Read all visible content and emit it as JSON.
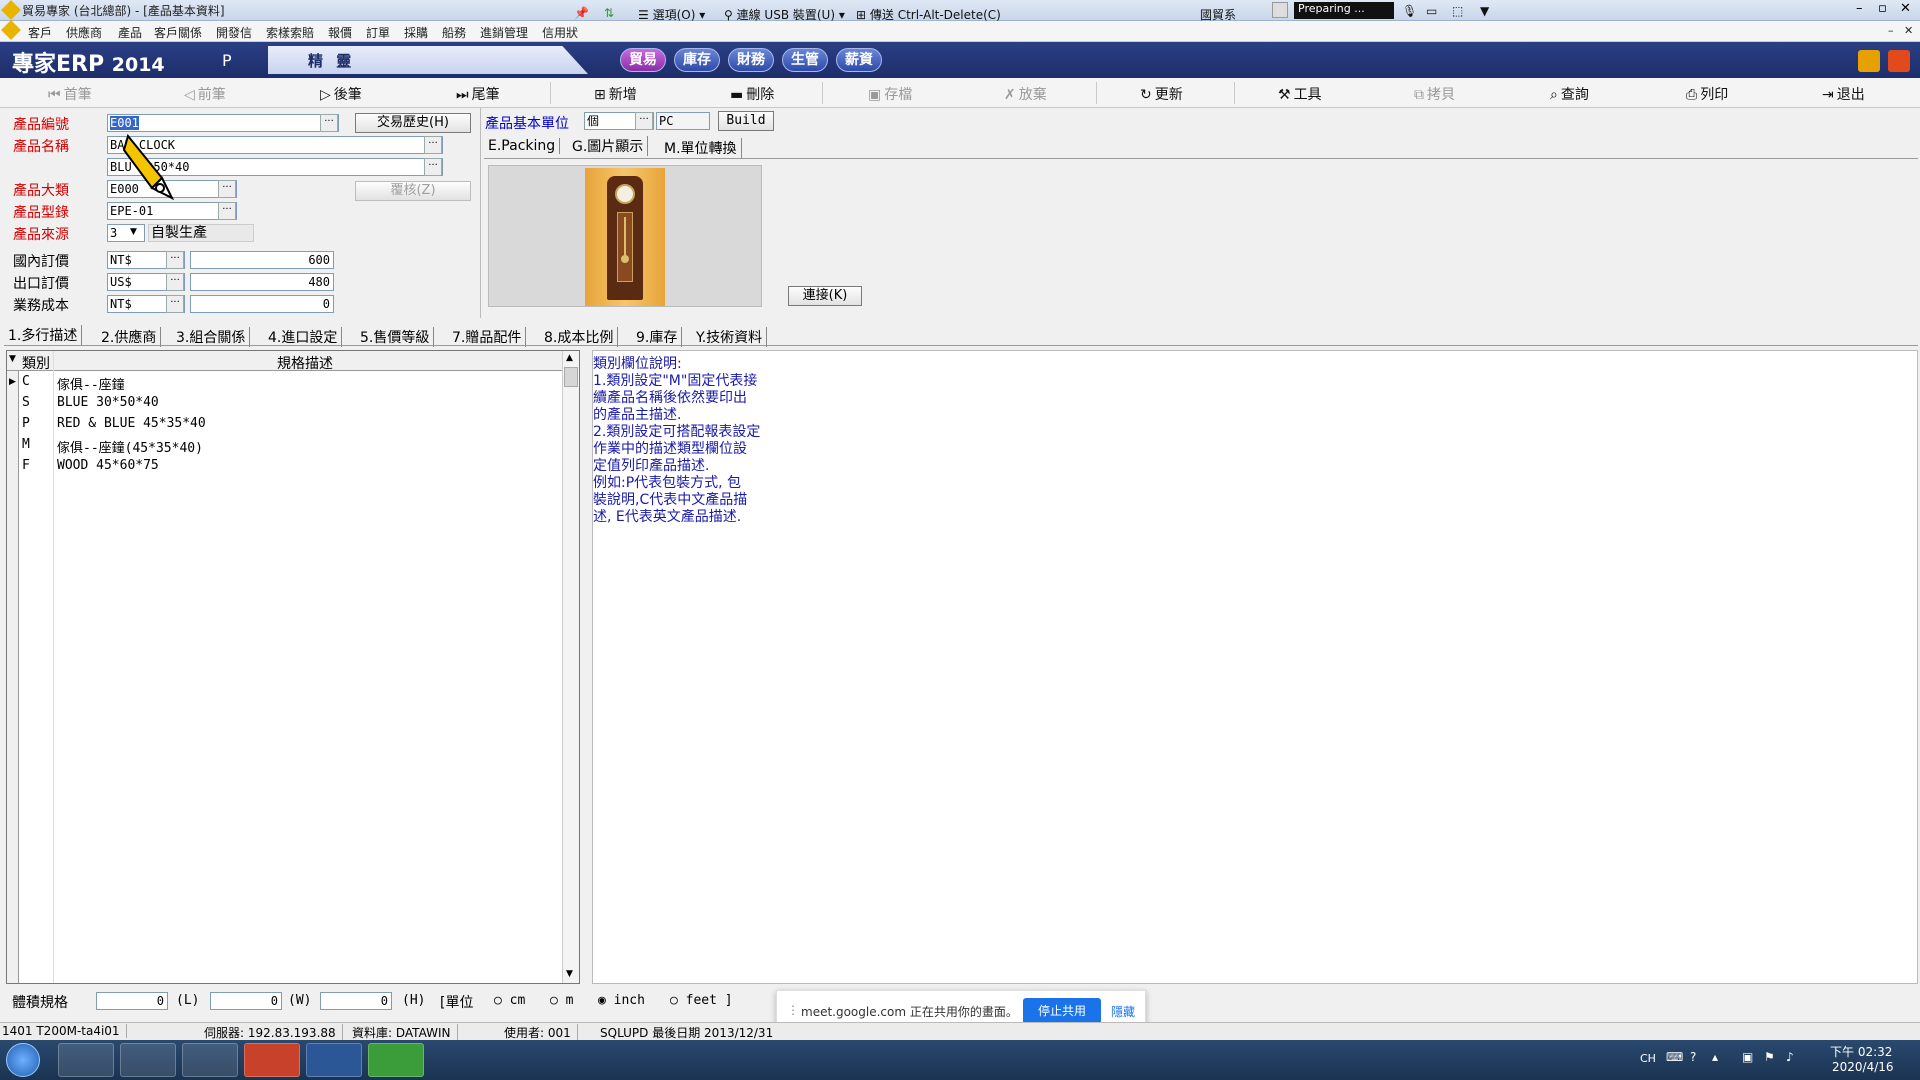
{
  "titlebar": {
    "title": "貿易專家 (台北總部) - [產品基本資料]"
  },
  "menubar": {
    "items": [
      "客戶",
      "供應商",
      "產品",
      "客戶關係",
      "開發信",
      "索樣索賠",
      "報價",
      "訂單",
      "採購",
      "船務",
      "進銷管理",
      "信用狀"
    ]
  },
  "remote_bar": {
    "options": "選項(O)",
    "usb": "連線 USB 裝置(U)",
    "cad": "傳送 Ctrl-Alt-Delete(C)",
    "lang": "國貿系",
    "preparing": "Preparing ..."
  },
  "banner": {
    "logo": "專家ERP",
    "year": "2014",
    "p": "P",
    "tab": "精 靈",
    "modules": [
      "貿易",
      "庫存",
      "財務",
      "生管",
      "薪資"
    ]
  },
  "toolbar": {
    "first": "首筆",
    "prev": "前筆",
    "next": "後筆",
    "last": "尾筆",
    "add": "新增",
    "delete": "刪除",
    "save": "存檔",
    "discard": "放棄",
    "update": "更新",
    "tools": "工具",
    "copy": "拷貝",
    "query": "查詢",
    "print": "列印",
    "exit": "退出"
  },
  "form": {
    "product_no_label": "產品編號",
    "product_no": "E001",
    "history_btn": "交易歷史(H)",
    "product_name_label": "產品名稱",
    "name_line1": "BAB   CLOCK",
    "name_line2": "BLU   3*50*40",
    "category_label": "產品大類",
    "category": "E000",
    "review_btn": "覆核(Z)",
    "model_label": "產品型錄",
    "model": "EPE-01",
    "source_label": "產品來源",
    "source_code": "3",
    "source_text": "自製生產",
    "domestic_label": "國內訂價",
    "domestic_cur": "NT$",
    "domestic_val": "600",
    "export_label": "出口訂價",
    "export_cur": "US$",
    "export_val": "480",
    "cost_label": "業務成本",
    "cost_cur": "NT$",
    "cost_val": "0",
    "unit_label": "產品基本單位",
    "unit": "個",
    "unit_code": "PC",
    "build_btn": "Build"
  },
  "subtabs": [
    "E.Packing",
    "G.圖片顯示",
    "M.單位轉換"
  ],
  "link_btn": "連接(K)",
  "tabs": [
    "1.多行描述",
    "2.供應商",
    "3.組合關係",
    "4.進口設定",
    "5.售價等級",
    "7.贈品配件",
    "8.成本比例",
    "9.庫存",
    "Y.技術資料"
  ],
  "grid": {
    "headers": [
      "類別",
      "規格描述"
    ],
    "rows": [
      [
        "C",
        "傢俱--座鐘"
      ],
      [
        "S",
        "BLUE 30*50*40"
      ],
      [
        "P",
        "RED & BLUE 45*35*40"
      ],
      [
        "M",
        "傢俱--座鐘(45*35*40)"
      ],
      [
        "F",
        "WOOD 45*60*75"
      ]
    ]
  },
  "notes": [
    "類別欄位說明:",
    "1.類別設定\"M\"固定代表接",
    "   續產品名稱後依然要印出",
    "   的產品主描述.",
    "2.類別設定可搭配報表設定",
    "   作業中的描述類型欄位設",
    "   定值列印產品描述.",
    "   例如:P代表包裝方式, 包",
    "   裝說明,C代表中文產品描",
    "   述, E代表英文產品描述."
  ],
  "volume": {
    "label": "體積規格",
    "l": "0",
    "l_suffix": "(L)",
    "w": "0",
    "w_suffix": "(W)",
    "h": "0",
    "h_suffix": "(H)",
    "unit_label": "[單位",
    "cm": "cm",
    "m": "m",
    "inch": "inch",
    "feet": "feet ]",
    "selected": "inch"
  },
  "statusbar": {
    "session": "1401 T200M-ta4i01",
    "server": "伺服器: 192.83.193.88",
    "db": "資料庫: DATAWIN",
    "user": "使用者: 001",
    "sqlupd": "SQLUPD 最後日期 2013/12/31"
  },
  "share": {
    "text": "meet.google.com 正在共用你的畫面。",
    "stop": "停止共用",
    "hide": "隱藏"
  },
  "taskbar": {
    "lang": "CH",
    "time": "下午 02:32",
    "date": "2020/4/16"
  },
  "colors": {
    "banner": "#1d2d6a",
    "label_red": "#d40000",
    "label_blue": "#0000cc",
    "notes_text": "#1a1aa8",
    "taskbar": "#1b3352"
  }
}
